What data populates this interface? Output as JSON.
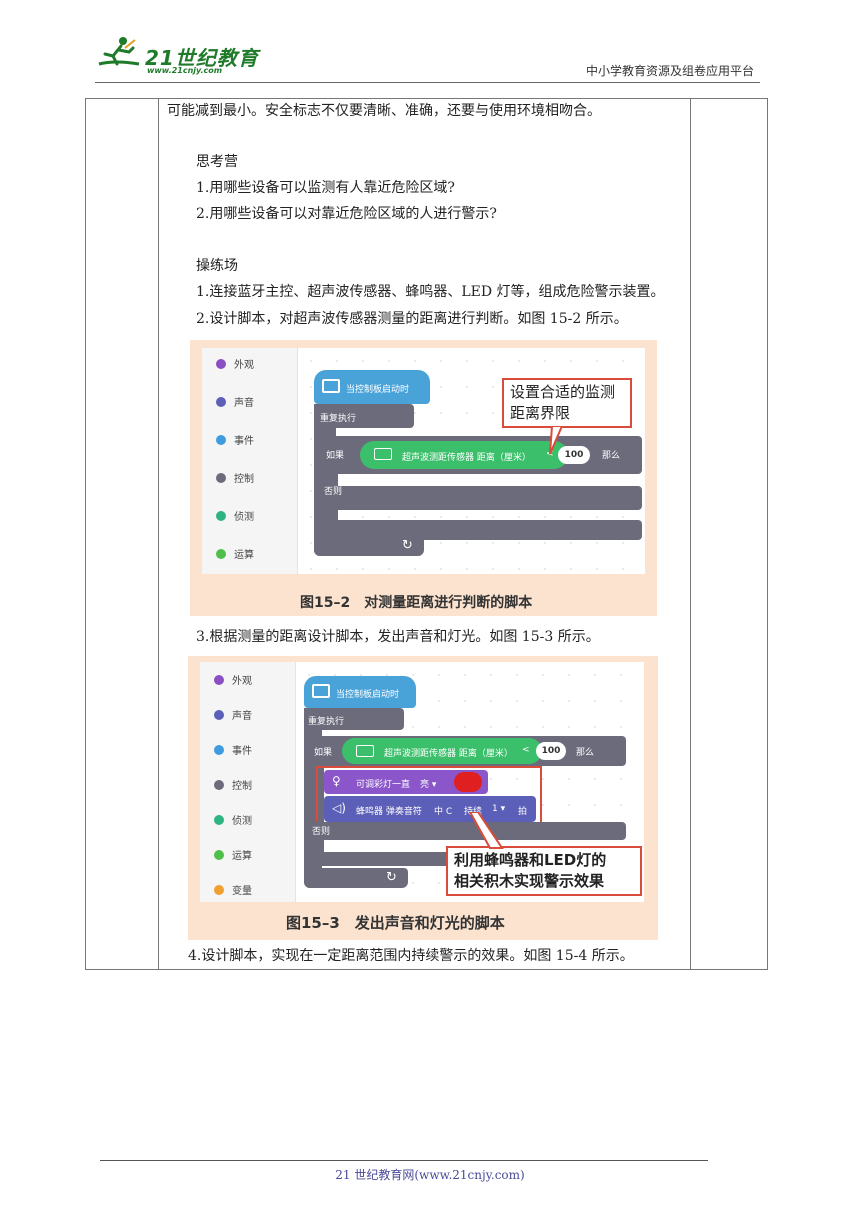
{
  "header": {
    "logo_text": "21世纪教育",
    "logo_url": "www.21cnjy.com",
    "right_text": "中小学教育资源及组卷应用平台"
  },
  "content": {
    "p1": "可能减到最小。安全标志不仅要清晰、准确，还要与使用环境相吻合。",
    "think_title": "思考营",
    "think_q1": "1.用哪些设备可以监测有人靠近危险区域?",
    "think_q2": "2.用哪些设备可以对靠近危险区域的人进行警示?",
    "practice_title": "操练场",
    "practice_1": "1.连接蓝牙主控、超声波传感器、蜂鸣器、LED 灯等，组成危险警示装置。",
    "practice_2": "2.设计脚本，对超声波传感器测量的距离进行判断。如图 15-2 所示。",
    "practice_3": "3.根据测量的距离设计脚本，发出声音和灯光。如图 15-3 所示。",
    "practice_4": "4.设计脚本，实现在一定距离范围内持续警示的效果。如图 15-4 所示。"
  },
  "categories_fig1": [
    {
      "label": "外观",
      "color": "#8a4fc2"
    },
    {
      "label": "声音",
      "color": "#5c5fb8"
    },
    {
      "label": "事件",
      "color": "#3f9be0"
    },
    {
      "label": "控制",
      "color": "#6b6b7b"
    },
    {
      "label": "侦测",
      "color": "#2fb383"
    },
    {
      "label": "运算",
      "color": "#4fbf4a"
    }
  ],
  "categories_fig2": [
    {
      "label": "外观",
      "color": "#8a4fc2"
    },
    {
      "label": "声音",
      "color": "#5c5fb8"
    },
    {
      "label": "事件",
      "color": "#3f9be0"
    },
    {
      "label": "控制",
      "color": "#6b6b7b"
    },
    {
      "label": "侦测",
      "color": "#2fb383"
    },
    {
      "label": "运算",
      "color": "#4fbf4a"
    },
    {
      "label": "变量",
      "color": "#f0a030"
    }
  ],
  "blocks": {
    "hat": "当控制板启动时",
    "repeat": "重复执行",
    "if": "如果",
    "sensor": "超声波测距传感器 距离（厘米）",
    "lt": "<",
    "value": "100",
    "then": "那么",
    "else": "否则",
    "led": "可调彩灯一直",
    "led_level": "亮 ▾",
    "buzzer": "蜂鸣器 弹奏音符",
    "note": "中 C",
    "duration": "持续",
    "beats_value": "1 ▾",
    "beats": "拍"
  },
  "fig1": {
    "callout": [
      "设置合适的监测",
      "距离界限"
    ],
    "caption": "图15–2　对测量距离进行判断的脚本"
  },
  "fig2": {
    "callout": [
      "利用蜂鸣器和LED灯的",
      "相关积木实现警示效果"
    ],
    "caption": "图15–3　发出声音和灯光的脚本"
  },
  "footer": {
    "text": "21 世纪教育网(www.21cnjy.com)"
  },
  "colors": {
    "accent_green": "#1f7a2a",
    "figure_bg": "#fbe3d0",
    "callout_border": "#d94b3a"
  }
}
